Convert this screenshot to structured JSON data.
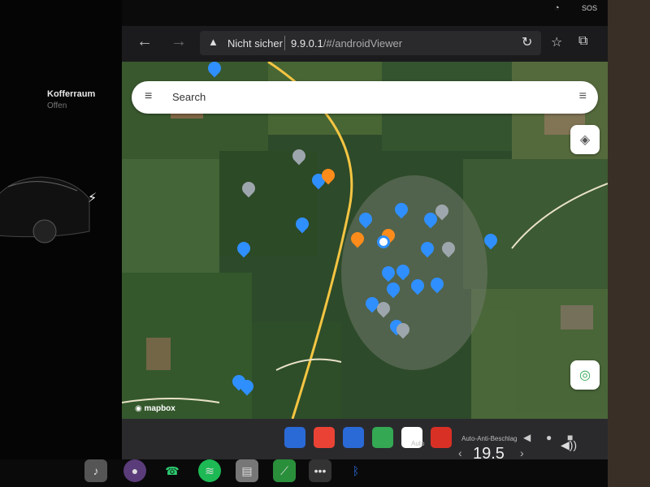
{
  "car_panel": {
    "trunk_title": "Kofferraum",
    "trunk_status": "Offen"
  },
  "status_bar": {
    "wifi_icon": "wifi-icon",
    "sos_label": "SOS"
  },
  "browser": {
    "back_icon": "arrow-left-icon",
    "forward_icon": "arrow-right-icon",
    "warning_icon": "warning-icon",
    "security_label": "Nicht sicher",
    "url_host": "9.9.0.1",
    "url_path": "/#/androidViewer",
    "reload_icon": "reload-icon",
    "bookmark_icon": "star-icon",
    "tab_icon": "tab-icon"
  },
  "map": {
    "search_placeholder": "Search",
    "menu_icon": "menu-icon",
    "filter_icon": "filter-icon",
    "layers_icon": "layers-icon",
    "locate_icon": "locate-icon",
    "attribution": "mapbox"
  },
  "android_nav": {
    "apps": [
      {
        "name": "signal-app-icon",
        "color": "#2a6ad6"
      },
      {
        "name": "maps-app-icon",
        "color": "#ea4335"
      },
      {
        "name": "dash-app-icon",
        "color": "#2a6ad6"
      },
      {
        "name": "location-app-icon",
        "color": "#34a853"
      },
      {
        "name": "browser-app-icon",
        "color": "#ffffff"
      },
      {
        "name": "go-app-icon",
        "color": "#d93025"
      }
    ],
    "back_icon": "triangle-back-icon",
    "home_icon": "circle-home-icon",
    "recents_icon": "square-recents-icon"
  },
  "climate": {
    "mode_label": "Auto-Anti-Beschlag",
    "temperature": "19.5",
    "auto_label": "Auto"
  },
  "dock": {
    "icons": [
      {
        "name": "music-note-icon",
        "glyph": "♪",
        "color": "#555"
      },
      {
        "name": "camera-icon",
        "glyph": "●",
        "color": "#5b3c7a"
      },
      {
        "name": "phone-icon",
        "glyph": "☎",
        "color": "#1a1a1a"
      },
      {
        "name": "spotify-icon",
        "glyph": "≋",
        "color": "#1db954"
      },
      {
        "name": "toybox-icon",
        "glyph": "▤",
        "color": "#777"
      },
      {
        "name": "stocks-icon",
        "glyph": "⟋",
        "color": "#2a8f3a"
      },
      {
        "name": "more-icon",
        "glyph": "•••",
        "color": "#333"
      },
      {
        "name": "bluetooth-icon",
        "glyph": "ᛒ",
        "color": "#2f6fe0"
      }
    ],
    "volume_icon": "volume-icon"
  },
  "colors": {
    "pin_blue": "#2f8fff",
    "pin_orange": "#ff8c1a",
    "pin_grey": "#9ea6ad",
    "road_yellow": "#f5c542"
  }
}
